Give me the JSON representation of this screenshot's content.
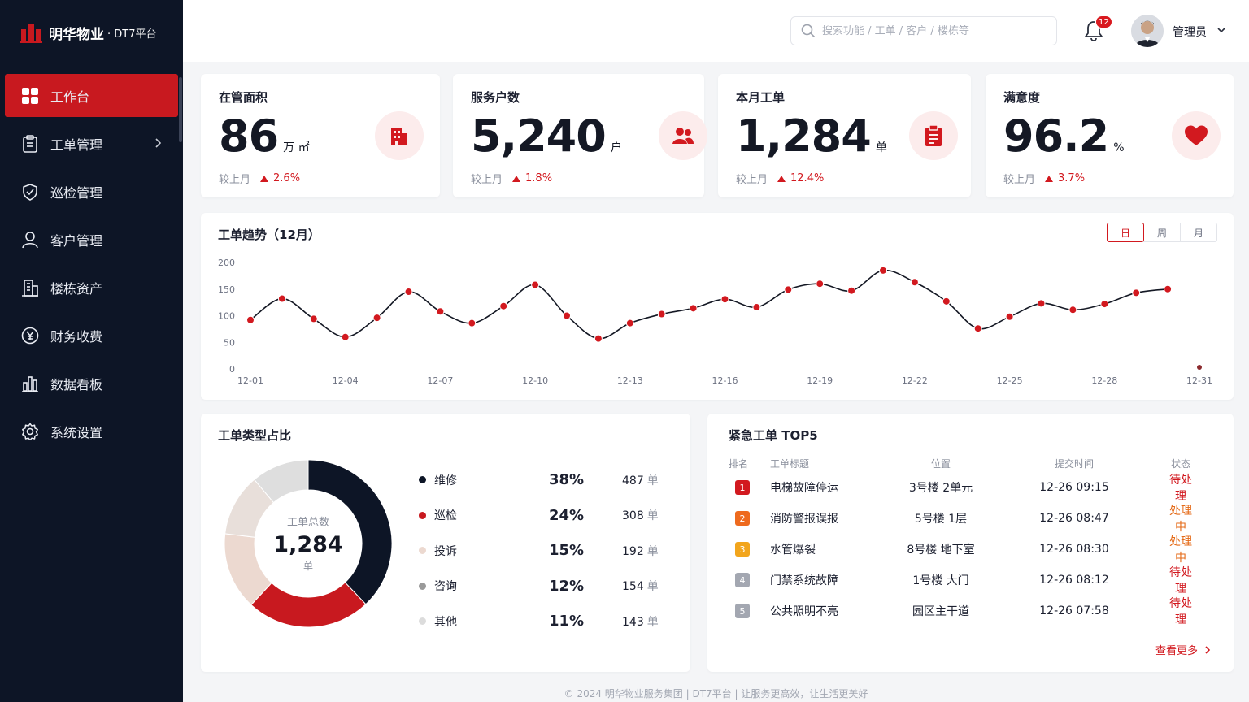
{
  "brand": {
    "name": "明华物业",
    "sub": "· DT7平台",
    "color": "#c8191f"
  },
  "nav": [
    {
      "label": "工作台",
      "icon": "dashboard-icon",
      "active": true
    },
    {
      "label": "工单管理",
      "icon": "clipboard-icon",
      "has_arrow": true
    },
    {
      "label": "巡检管理",
      "icon": "shield-check-icon"
    },
    {
      "label": "客户管理",
      "icon": "user-icon"
    },
    {
      "label": "楼栋资产",
      "icon": "building-icon"
    },
    {
      "label": "财务收费",
      "icon": "yen-icon"
    },
    {
      "label": "数据看板",
      "icon": "bar-chart-icon"
    },
    {
      "label": "系统设置",
      "icon": "gear-icon"
    }
  ],
  "header": {
    "search_placeholder": "搜索功能 / 工单 / 客户 / 楼栋等",
    "notifications": "12",
    "user": "管理员"
  },
  "stats": [
    {
      "label": "在管面积",
      "value": "86",
      "unit": "万 ㎡",
      "cmp": "较上月",
      "change": "2.6%",
      "icon": "building-icon"
    },
    {
      "label": "服务户数",
      "value": "5,240",
      "unit": "户",
      "cmp": "较上月",
      "change": "1.8%",
      "icon": "users-icon"
    },
    {
      "label": "本月工单",
      "value": "1,284",
      "unit": "单",
      "cmp": "较上月",
      "change": "12.4%",
      "icon": "clipboard-icon"
    },
    {
      "label": "满意度",
      "value": "96.2",
      "unit": "%",
      "cmp": "较上月",
      "change": "3.7%",
      "icon": "heart-icon"
    }
  ],
  "trend": {
    "title": "工单趋势（12月）",
    "tabs": [
      "日",
      "周",
      "月"
    ],
    "active_tab": 0
  },
  "donut": {
    "title": "工单类型占比",
    "center_label": "工单总数",
    "center_value": "1,284",
    "center_unit": "单",
    "unit": "单"
  },
  "top5": {
    "title": "紧急工单 TOP5",
    "headers": [
      "排名",
      "工单标题",
      "位置",
      "提交时间",
      "状态"
    ],
    "rows": [
      {
        "rank": "1",
        "title": "电梯故障停运",
        "loc": "3号楼 2单元",
        "time": "12-26 09:15",
        "status": "待处理",
        "kind": "pending",
        "color": "#d2191f"
      },
      {
        "rank": "2",
        "title": "消防警报误报",
        "loc": "5号楼 1层",
        "time": "12-26 08:47",
        "status": "处理中",
        "kind": "doing",
        "color": "#ee6a1e"
      },
      {
        "rank": "3",
        "title": "水管爆裂",
        "loc": "8号楼 地下室",
        "time": "12-26 08:30",
        "status": "处理中",
        "kind": "doing",
        "color": "#f2a51c"
      },
      {
        "rank": "4",
        "title": "门禁系统故障",
        "loc": "1号楼 大门",
        "time": "12-26 08:12",
        "status": "待处理",
        "kind": "pending",
        "color": "#a3a7b1"
      },
      {
        "rank": "5",
        "title": "公共照明不亮",
        "loc": "园区主干道",
        "time": "12-26 07:58",
        "status": "待处理",
        "kind": "pending",
        "color": "#a3a7b1"
      }
    ],
    "more": "查看更多"
  },
  "footer": "© 2024 明华物业服务集团 | DT7平台 | 让服务更高效，让生活更美好",
  "chart_data": [
    {
      "type": "line",
      "title": "工单趋势（12月）",
      "ylim": [
        0,
        200
      ],
      "yticks": [
        0,
        50,
        100,
        150,
        200
      ],
      "xticks": [
        "12-01",
        "12-04",
        "12-07",
        "12-10",
        "12-13",
        "12-16",
        "12-19",
        "12-22",
        "12-25",
        "12-28",
        "12-31"
      ],
      "x": [
        "12-01",
        "12-02",
        "12-03",
        "12-04",
        "12-05",
        "12-06",
        "12-07",
        "12-08",
        "12-09",
        "12-10",
        "12-11",
        "12-12",
        "12-13",
        "12-14",
        "12-15",
        "12-16",
        "12-17",
        "12-18",
        "12-19",
        "12-20",
        "12-21",
        "12-22",
        "12-23",
        "12-24",
        "12-25",
        "12-26",
        "12-27",
        "12-28",
        "12-29",
        "12-30",
        "12-31"
      ],
      "series": [
        {
          "values": [
            92,
            132,
            94,
            60,
            96,
            145,
            108,
            86,
            118,
            158,
            100,
            57,
            86,
            103,
            114,
            131,
            116,
            149,
            160,
            147,
            185,
            163,
            127,
            76,
            98,
            123,
            111,
            122,
            143,
            150,
            0
          ],
          "color": "#d2191f"
        }
      ],
      "grid": false
    },
    {
      "type": "pie",
      "title": "工单类型占比",
      "labels": [
        "维修",
        "巡检",
        "投诉",
        "咨询",
        "其他"
      ],
      "values": [
        487,
        308,
        192,
        154,
        143
      ],
      "percents": [
        "38%",
        "24%",
        "15%",
        "12%",
        "11%"
      ],
      "colors": [
        "#0d1526",
        "#c8191f",
        "#ecd9d0",
        "#e8dfda",
        "#dedede"
      ],
      "legend_colors": [
        "#0d1526",
        "#c8191f",
        "#ecd9d0",
        "#9a9a9a",
        "#dcdcdc"
      ]
    }
  ]
}
